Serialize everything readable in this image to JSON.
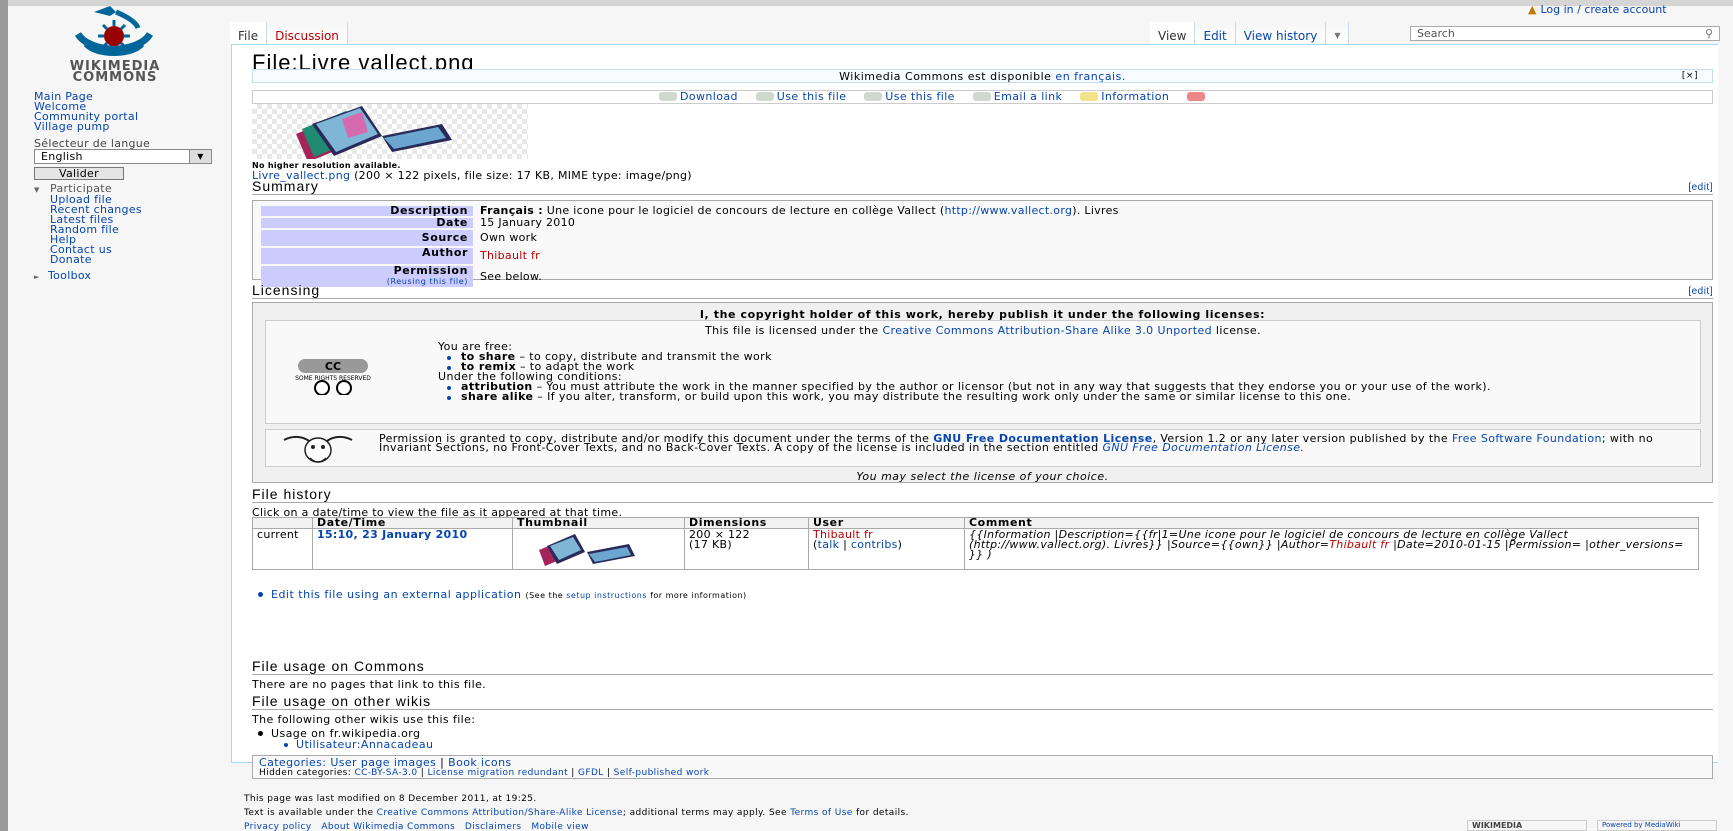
{
  "header": {
    "personal_login": "Log in / create account",
    "tabs_left": [
      "File",
      "Discussion"
    ],
    "tabs_right": [
      "View",
      "Edit",
      "View history"
    ],
    "search_placeholder": "Search"
  },
  "logo": {
    "line1": "WIKIMEDIA",
    "line2": "COMMONS"
  },
  "sidebar": {
    "nav": [
      "Main Page",
      "Welcome",
      "Community portal",
      "Village pump"
    ],
    "language_heading": "Sélecteur de langue",
    "language_value": "English",
    "valider_label": "Valider",
    "participate_heading": "Participate",
    "participate": [
      "Upload file",
      "Recent changes",
      "Latest files",
      "Random file",
      "Help",
      "Contact us",
      "Donate"
    ],
    "toolbox_heading": "Toolbox"
  },
  "page": {
    "title": "File:Livre vallect.png",
    "availability": "Wikimedia Commons est disponible",
    "availability_link": "en français.",
    "actions": [
      "Download",
      "Use this file",
      "Use this file",
      "Email a link",
      "Information"
    ],
    "no_higher_res": "No higher resolution available.",
    "file_link": "Livre_vallect.png",
    "file_meta": "(200 × 122 pixels, file size: 17 KB, MIME type: image/png)"
  },
  "summary": {
    "heading": "Summary",
    "edit": "[edit]",
    "description_label": "Description",
    "description_lang": "Français :",
    "description_text": "Une icone pour le logiciel de concours de lecture en collège Vallect (",
    "description_url": "http://www.vallect.org",
    "description_tail": "). Livres",
    "date_label": "Date",
    "date_value": "15 January 2010",
    "source_label": "Source",
    "source_value": "Own work",
    "author_label": "Author",
    "author_value": "Thibault fr",
    "permission_label": "Permission",
    "permission_sub": "(Reusing this file)",
    "permission_value": "See below."
  },
  "licensing": {
    "heading": "Licensing",
    "edit": "[edit]",
    "title": "I, the copyright holder of this work, hereby publish it under the following licenses:",
    "cc_line_pre": "This file is licensed under the",
    "cc_link": "Creative Commons Attribution-Share Alike 3.0 Unported",
    "cc_line_post": "license.",
    "free_heading": "You are free:",
    "share_b": "to share",
    "share_t": "– to copy, distribute and transmit the work",
    "remix_b": "to remix",
    "remix_t": "– to adapt the work",
    "conditions_heading": "Under the following conditions:",
    "attr_b": "attribution",
    "attr_t": "– You must attribute the work in the manner specified by the author or licensor (but not in any way that suggests that they endorse you or your use of the work).",
    "sa_b": "share alike",
    "sa_t": "– If you alter, transform, or build upon this work, you may distribute the resulting work only under the same or similar license to this one.",
    "cc_logo_text": "SOME RIGHTS RESERVED",
    "gfdl_1": "Permission is granted to copy, distribute and/or modify this document under the terms of the",
    "gfdl_link1": "GNU Free Documentation License",
    "gfdl_2": ", Version 1.2 or any later version published by the",
    "gfdl_link2": "Free Software Foundation",
    "gfdl_3": "; with no Invariant Sections, no Front-Cover Texts, and no Back-Cover Texts. A copy of the license is included in the section entitled",
    "gfdl_link3": "GNU Free Documentation License.",
    "choose": "You may select the license of your choice."
  },
  "history": {
    "heading": "File history",
    "note": "Click on a date/time to view the file as it appeared at that time.",
    "columns": [
      "",
      "Date/Time",
      "Thumbnail",
      "Dimensions",
      "User",
      "Comment"
    ],
    "row": {
      "status": "current",
      "datetime": "15:10, 23 January 2010",
      "dim1": "200 × 122",
      "dim2": "(17 KB)",
      "user": "Thibault fr",
      "talk": "talk",
      "contribs": "contribs",
      "comment_pre": "{{Information |Description={{fr|1=Une icone pour le logiciel de concours de lecture en collège Vallect (http://www.vallect.org). Livres}} |Source={{own}} |Author=",
      "comment_user": "Thibault fr",
      "comment_post": "|Date=2010-01-15 |Permission= |other_versions= }} )"
    }
  },
  "external": {
    "link": "Edit this file using an external application",
    "note_pre": "(See the",
    "note_link": "setup instructions",
    "note_post": "for more information)"
  },
  "usage": {
    "heading": "File usage on Commons",
    "text": "There are no pages that link to this file."
  },
  "other_usage": {
    "heading": "File usage on other wikis",
    "text": "The following other wikis use this file:",
    "wiki": "Usage on fr.wikipedia.org",
    "page": "Utilisateur:Annacadeau"
  },
  "categories": {
    "label": "Categories:",
    "items": [
      "User page images",
      "Book icons"
    ],
    "hidden_label": "Hidden categories:",
    "hidden": [
      "CC-BY-SA-3.0",
      "License migration redundant",
      "GFDL",
      "Self-published work"
    ]
  },
  "footer": {
    "modified": "This page was last modified on 8 December 2011, at 19:25.",
    "text_pre": "Text is available under the",
    "text_link": "Creative Commons Attribution/Share-Alike License",
    "text_mid": "; additional terms may apply. See",
    "terms_link": "Terms of Use",
    "text_post": "for details.",
    "links": [
      "Privacy policy",
      "About Wikimedia Commons",
      "Disclaimers",
      "Mobile view"
    ],
    "logo_wm": "WIKIMEDIA",
    "logo_mw": "Powered by MediaWiki"
  },
  "colors": {
    "link": "#0645ad",
    "redlink": "#ba0000",
    "key_bg": "#ccccff",
    "logo_blue": "#006699",
    "logo_red": "#990000"
  }
}
